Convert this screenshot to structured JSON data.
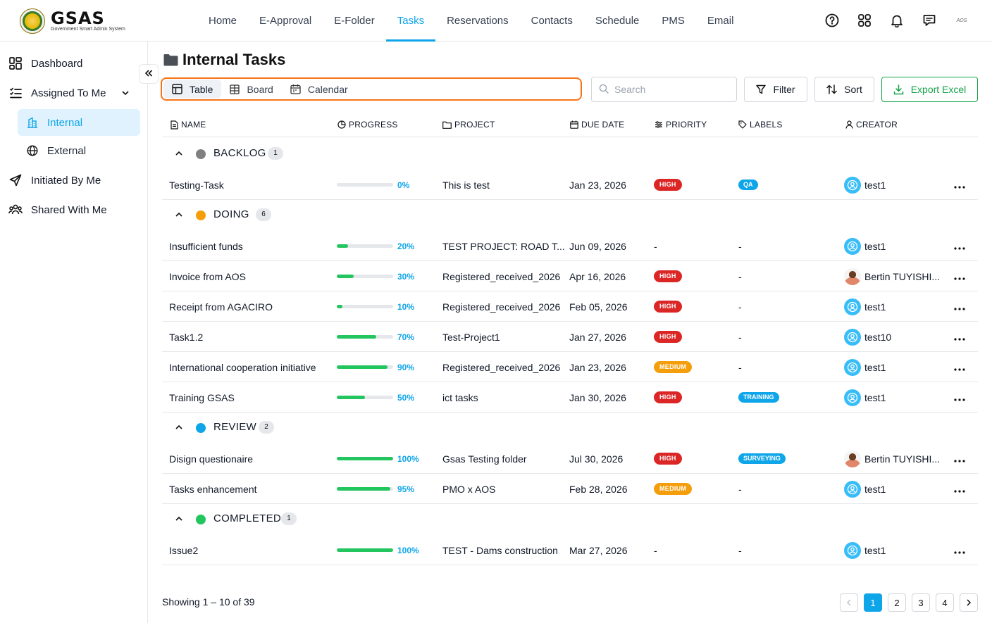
{
  "app": {
    "logo_title": "GSAS",
    "logo_subtitle": "Government Smart Admin System",
    "account_label": "AOS"
  },
  "nav": [
    {
      "label": "Home",
      "active": false
    },
    {
      "label": "E-Approval",
      "active": false
    },
    {
      "label": "E-Folder",
      "active": false
    },
    {
      "label": "Tasks",
      "active": true
    },
    {
      "label": "Reservations",
      "active": false
    },
    {
      "label": "Contacts",
      "active": false
    },
    {
      "label": "Schedule",
      "active": false
    },
    {
      "label": "PMS",
      "active": false
    },
    {
      "label": "Email",
      "active": false
    }
  ],
  "top_icons": [
    "help-icon",
    "apps-grid-icon",
    "bell-icon",
    "chat-icon"
  ],
  "sidebar": {
    "items": [
      {
        "label": "Dashboard",
        "icon": "dashboard-icon"
      },
      {
        "label": "Assigned To Me",
        "icon": "checklist-icon",
        "expanded": true
      },
      {
        "label": "Internal",
        "icon": "building-icon",
        "active": true
      },
      {
        "label": "External",
        "icon": "globe-icon"
      },
      {
        "label": "Initiated By Me",
        "icon": "send-icon"
      },
      {
        "label": "Shared With Me",
        "icon": "users-icon"
      }
    ]
  },
  "page": {
    "title": "Internal Tasks"
  },
  "toolbar": {
    "views": [
      "Table",
      "Board",
      "Calendar"
    ],
    "active_view": "Table",
    "search_placeholder": "Search",
    "filter_label": "Filter",
    "sort_label": "Sort",
    "export_label": "Export Excel"
  },
  "columns": [
    "NAME",
    "PROGRESS",
    "PROJECT",
    "DUE DATE",
    "PRIORITY",
    "LABELS",
    "CREATOR"
  ],
  "groups": [
    {
      "name": "BACKLOG",
      "count": "1",
      "color": "#808080",
      "rows": [
        {
          "name": "Testing-Task",
          "progress": 0,
          "progress_label": "0%",
          "project": "This is test",
          "due": "Jan 23, 2026",
          "priority": "HIGH",
          "label": "QA",
          "creator": "test1",
          "photo": false
        }
      ]
    },
    {
      "name": "DOING",
      "count": "6",
      "color": "#f59e0b",
      "rows": [
        {
          "name": "Insufficient funds",
          "progress": 20,
          "progress_label": "20%",
          "project": "TEST PROJECT: ROAD T...",
          "due": "Jun 09, 2026",
          "priority": "-",
          "label": "-",
          "creator": "test1",
          "photo": false
        },
        {
          "name": "Invoice from AOS",
          "progress": 30,
          "progress_label": "30%",
          "project": "Registered_received_2026",
          "due": "Apr 16, 2026",
          "priority": "HIGH",
          "label": "-",
          "creator": "Bertin TUYISHI...",
          "photo": true
        },
        {
          "name": "Receipt from AGACIRO",
          "progress": 10,
          "progress_label": "10%",
          "project": "Registered_received_2026",
          "due": "Feb 05, 2026",
          "priority": "HIGH",
          "label": "-",
          "creator": "test1",
          "photo": false
        },
        {
          "name": "Task1.2",
          "progress": 70,
          "progress_label": "70%",
          "project": "Test-Project1",
          "due": "Jan 27, 2026",
          "priority": "HIGH",
          "label": "-",
          "creator": "test10",
          "photo": false
        },
        {
          "name": "International cooperation initiative",
          "progress": 90,
          "progress_label": "90%",
          "project": "Registered_received_2026",
          "due": "Jan 23, 2026",
          "priority": "MEDIUM",
          "label": "-",
          "creator": "test1",
          "photo": false
        },
        {
          "name": "Training GSAS",
          "progress": 50,
          "progress_label": "50%",
          "project": "ict tasks",
          "due": "Jan 30, 2026",
          "priority": "HIGH",
          "label": "TRAINING",
          "creator": "test1",
          "photo": false
        }
      ]
    },
    {
      "name": "REVIEW",
      "count": "2",
      "color": "#0ea5e9",
      "rows": [
        {
          "name": "Disign questionaire",
          "progress": 100,
          "progress_label": "100%",
          "project": "Gsas Testing folder",
          "due": "Jul 30, 2026",
          "priority": "HIGH",
          "label": "SURVEYING",
          "creator": "Bertin TUYISHI...",
          "photo": true
        },
        {
          "name": "Tasks enhancement",
          "progress": 95,
          "progress_label": "95%",
          "project": "PMO x AOS",
          "due": "Feb 28, 2026",
          "priority": "MEDIUM",
          "label": "-",
          "creator": "test1",
          "photo": false
        }
      ]
    },
    {
      "name": "COMPLETED",
      "count": "1",
      "color": "#22c55e",
      "rows": [
        {
          "name": "Issue2",
          "progress": 100,
          "progress_label": "100%",
          "project": "TEST - Dams construction",
          "due": "Mar 27, 2026",
          "priority": "-",
          "label": "-",
          "creator": "test1",
          "photo": false
        }
      ]
    }
  ],
  "footer": {
    "showing": "Showing 1 – 10 of 39",
    "pages": [
      "1",
      "2",
      "3",
      "4"
    ],
    "current_page": "1"
  }
}
